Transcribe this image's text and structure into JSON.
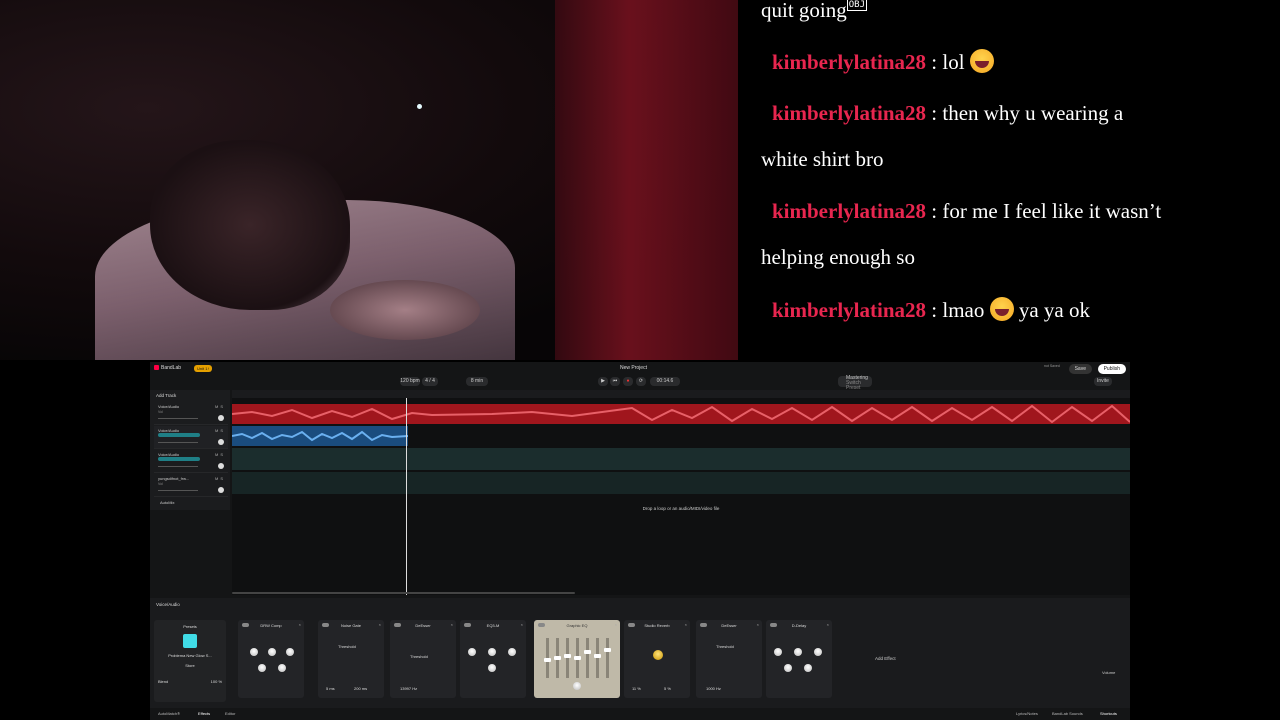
{
  "chat": {
    "top_text": "quit going",
    "obj_marker": "OBJ",
    "messages": [
      {
        "user": "kimberlylatina28",
        "sep": ":",
        "text": "lol"
      },
      {
        "user": "kimberlylatina28",
        "sep": ":",
        "text": "then why u wearing a"
      },
      {
        "cont": "white shirt bro"
      },
      {
        "user": "kimberlylatina28",
        "sep": ":",
        "text": "for me I feel like it wasn’t"
      },
      {
        "cont": "helping enough so"
      },
      {
        "user": "kimberlylatina28",
        "sep": ":",
        "text": "lmao",
        "after": "ya ya ok"
      }
    ],
    "user_color": "#e8264f"
  },
  "app": {
    "brand": "BandLab",
    "unit_badge": "Unit 1↑",
    "project_title": "New Project",
    "tempo": "120 bpm",
    "time_sig": "4 / 4",
    "key": "8 min",
    "time": "00:14.6",
    "mastering": "Mastering",
    "mastering_sub": "Switch Preset",
    "save": "Save",
    "publish": "Publish",
    "invite": "Invite",
    "not_saved": "not Saved",
    "add_track": "Add Track",
    "tracks": [
      {
        "name": "Voice/Audio",
        "sub": "Vol"
      },
      {
        "name": "Voice/Audio",
        "fx": "Problema New Glow S..."
      },
      {
        "name": "Voice/Audio",
        "fx": "Problema New Glow S..."
      },
      {
        "name": "yungsdifnot_frw...",
        "sub": "Vol"
      }
    ],
    "autotune": "AutoMix",
    "drop_text": "Drop a loop or an audio/MIDI/video file",
    "fx_header": "Voice/Audio",
    "presets": {
      "title": "Presets",
      "name": "Problema New Glow S...",
      "store": "Store",
      "blend": "Blend",
      "blend_val": "100 %"
    },
    "effects": [
      {
        "name": "DRW Comp",
        "vals": []
      },
      {
        "name": "Noise Gate",
        "vals": [
          "5 ms",
          "200 ms"
        ]
      },
      {
        "name": "DeEsser",
        "vals": [
          "13997 Hz"
        ]
      },
      {
        "name": "EQ3-M",
        "vals": []
      },
      {
        "name": "Graphic EQ",
        "vals": []
      },
      {
        "name": "Studio Reverb",
        "vals": [
          "11 %",
          "5 %"
        ]
      },
      {
        "name": "DeEsser",
        "vals": [
          "1000 Hz"
        ]
      },
      {
        "name": "D-Delay",
        "vals": []
      }
    ],
    "threshold": "Threshold",
    "add_effect": "Add Effect",
    "volume": "Volume",
    "bottom": {
      "automix": "AutoMatch®",
      "effects": "Effects",
      "editor": "Editor",
      "lyrics": "Lyrics/Notes",
      "soundkits": "BandLab Sounds",
      "shortcuts": "Shortcuts"
    },
    "colors": {
      "red_clip": "#a0161d",
      "blue_clip": "#1a4c7e",
      "accent": "#40dbe6",
      "unit": "#e5a000"
    }
  }
}
